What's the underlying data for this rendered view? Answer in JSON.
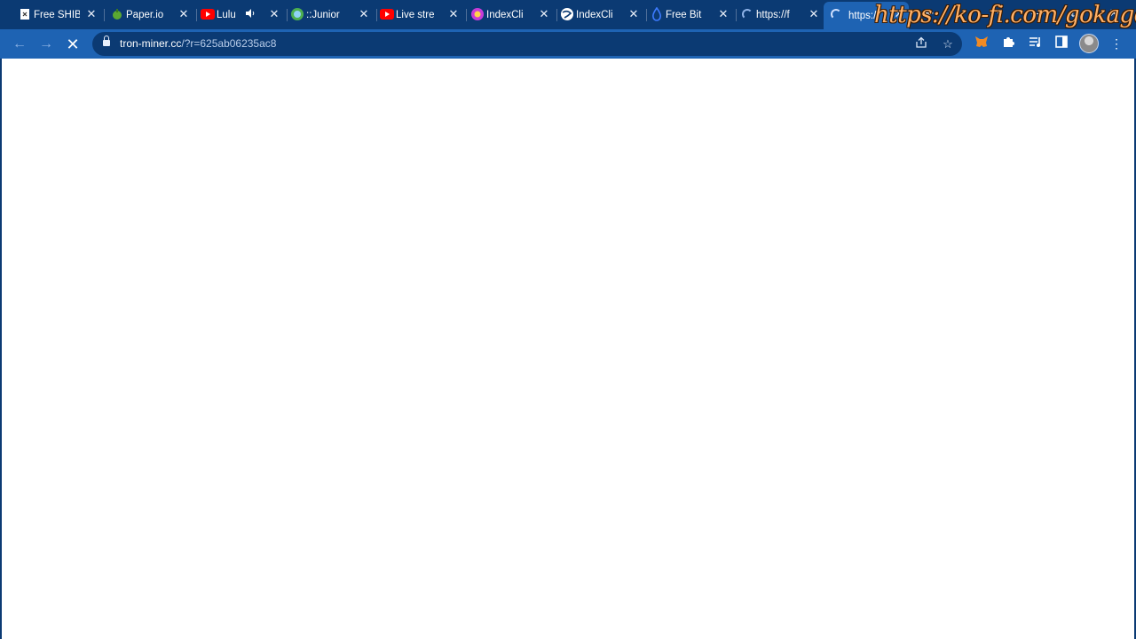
{
  "tabs": [
    {
      "title": "Free SHIB",
      "icon": "document-icon",
      "favcolor": "#ffffff"
    },
    {
      "title": "Paper.io",
      "icon": "paperio-icon",
      "favcolor": "#5aa832"
    },
    {
      "title": "Lulu",
      "icon": "youtube-icon",
      "favcolor": "#ff0000",
      "muted_icon": "speaker-icon"
    },
    {
      "title": "::Junior",
      "icon": "globe-green-icon",
      "favcolor": "#4caf50"
    },
    {
      "title": "Live stre",
      "icon": "youtube-icon",
      "favcolor": "#ff0000"
    },
    {
      "title": "IndexCli",
      "icon": "indexclick-icon",
      "favcolor": "#c83cd8"
    },
    {
      "title": "IndexCli",
      "icon": "globe-icon",
      "favcolor": "#ffffff"
    },
    {
      "title": "Free Bit",
      "icon": "drop-icon",
      "favcolor": "#2b6bff"
    },
    {
      "title": "https://f",
      "icon": "loading-spinner-icon",
      "favcolor": "#8fb3e8"
    },
    {
      "title": "https://",
      "icon": "loading-spinner-icon",
      "favcolor": "#cfe0ff",
      "active": true
    }
  ],
  "window": {
    "minimize": "—",
    "maximize": "⧉",
    "close": "✕",
    "new_tab": "+",
    "tab_search": "⌄"
  },
  "watermark": "https://ko-fi.com/gokagen",
  "toolbar": {
    "back": "←",
    "forward": "→",
    "stop": "✕",
    "url_host": "tron-miner.cc",
    "url_rest": "/?r=625ab06235ac8"
  },
  "colors": {
    "frame": "#0b3a73",
    "toolbar": "#1e63b3"
  }
}
